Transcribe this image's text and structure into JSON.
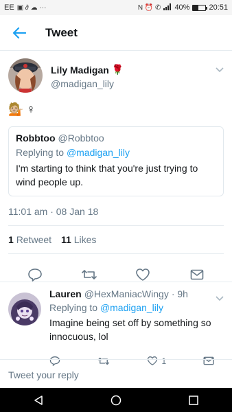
{
  "status_bar": {
    "carrier": "EE",
    "left_glyphs": "▣ ∂ ☁ ···",
    "right_glyphs": "N ⏰ ✆",
    "battery": "40%",
    "battery_level": 0.4,
    "time": "20:51"
  },
  "header": {
    "title": "Tweet"
  },
  "tweet": {
    "author": {
      "name": "Lily Madigan",
      "name_emoji": "🌹",
      "handle": "@madigan_lily"
    },
    "body": {
      "emoji": "💁🏼",
      "symbol": "♀"
    },
    "quote": {
      "name": "Robbtoo",
      "handle": "@Robbtoo",
      "replying_prefix": "Replying to",
      "replying_to": "@madigan_lily",
      "text": "I'm starting to think that you're just trying to wind people up."
    },
    "timestamp": "11:01 am · 08 Jan 18",
    "stats": {
      "retweets_count": "1",
      "retweets_label": "Retweet",
      "likes_count": "11",
      "likes_label": "Likes"
    }
  },
  "reply": {
    "name": "Lauren",
    "handle": "@HexManiacWingy",
    "time": "· 9h",
    "replying_prefix": "Replying to",
    "replying_to": "@madigan_lily",
    "text": "Imagine being set off by something so innocuous, lol",
    "likes": "1"
  },
  "compose": {
    "placeholder": "Tweet your reply"
  },
  "colors": {
    "accent": "#1da1f2",
    "secondary_text": "#657786",
    "divider": "#e6ecf0"
  }
}
